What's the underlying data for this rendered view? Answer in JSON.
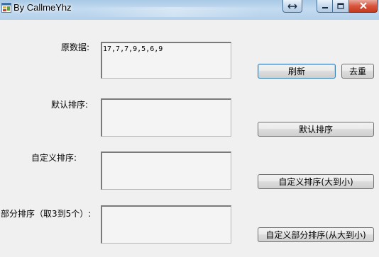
{
  "window": {
    "title": "By CallmeYhz",
    "controls": {
      "extra_icon": "swap-arrows-icon",
      "minimize_icon": "minimize-icon",
      "maximize_icon": "maximize-icon",
      "close_icon": "close-icon"
    },
    "colors": {
      "titlebar": "#b4d0ea",
      "close": "#c23a20",
      "background": "#f0f0f0"
    }
  },
  "labels": {
    "raw_data": "原数据:",
    "default_sort": "默认排序:",
    "custom_sort": "自定义排序:",
    "partial_sort": "部分排序（取3到5个）:"
  },
  "textboxes": {
    "raw_data": "17,7,7,9,5,6,9",
    "default_sort": "",
    "custom_sort": "",
    "partial_sort": ""
  },
  "buttons": {
    "refresh": "刷新",
    "dedupe": "去重",
    "default_sort": "默认排序",
    "custom_sort": "自定义排序(大到小)",
    "custom_partial_sort": "自定义部分排序(从大到小)"
  }
}
